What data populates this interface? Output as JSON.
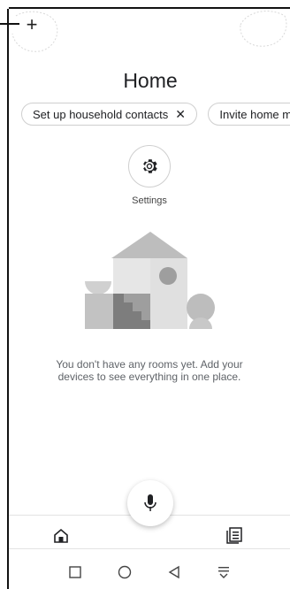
{
  "header": {
    "add_label": "+"
  },
  "page": {
    "title": "Home"
  },
  "chips": [
    {
      "label": "Set up household contacts",
      "close": "✕"
    },
    {
      "label": "Invite home m"
    }
  ],
  "settings": {
    "label": "Settings",
    "icon": "gear-icon"
  },
  "empty_state": {
    "text": "You don't have any rooms yet. Add your devices to see everything in one place."
  },
  "mic": {
    "icon": "mic-icon"
  },
  "bottom_nav": [
    {
      "name": "home",
      "icon": "home-icon"
    },
    {
      "name": "feed",
      "icon": "feed-icon"
    }
  ],
  "system_nav": [
    {
      "name": "recent-apps",
      "icon": "square-icon"
    },
    {
      "name": "home",
      "icon": "circle-icon"
    },
    {
      "name": "back",
      "icon": "triangle-back-icon"
    },
    {
      "name": "notifications",
      "icon": "notification-shade-icon"
    }
  ],
  "colors": {
    "text": "#202124",
    "muted": "#5f6368",
    "chip_border": "#cfcfcf",
    "illustration_light": "#e0e0e0",
    "illustration_mid": "#bdbdbd",
    "illustration_dark": "#9e9e9e"
  }
}
